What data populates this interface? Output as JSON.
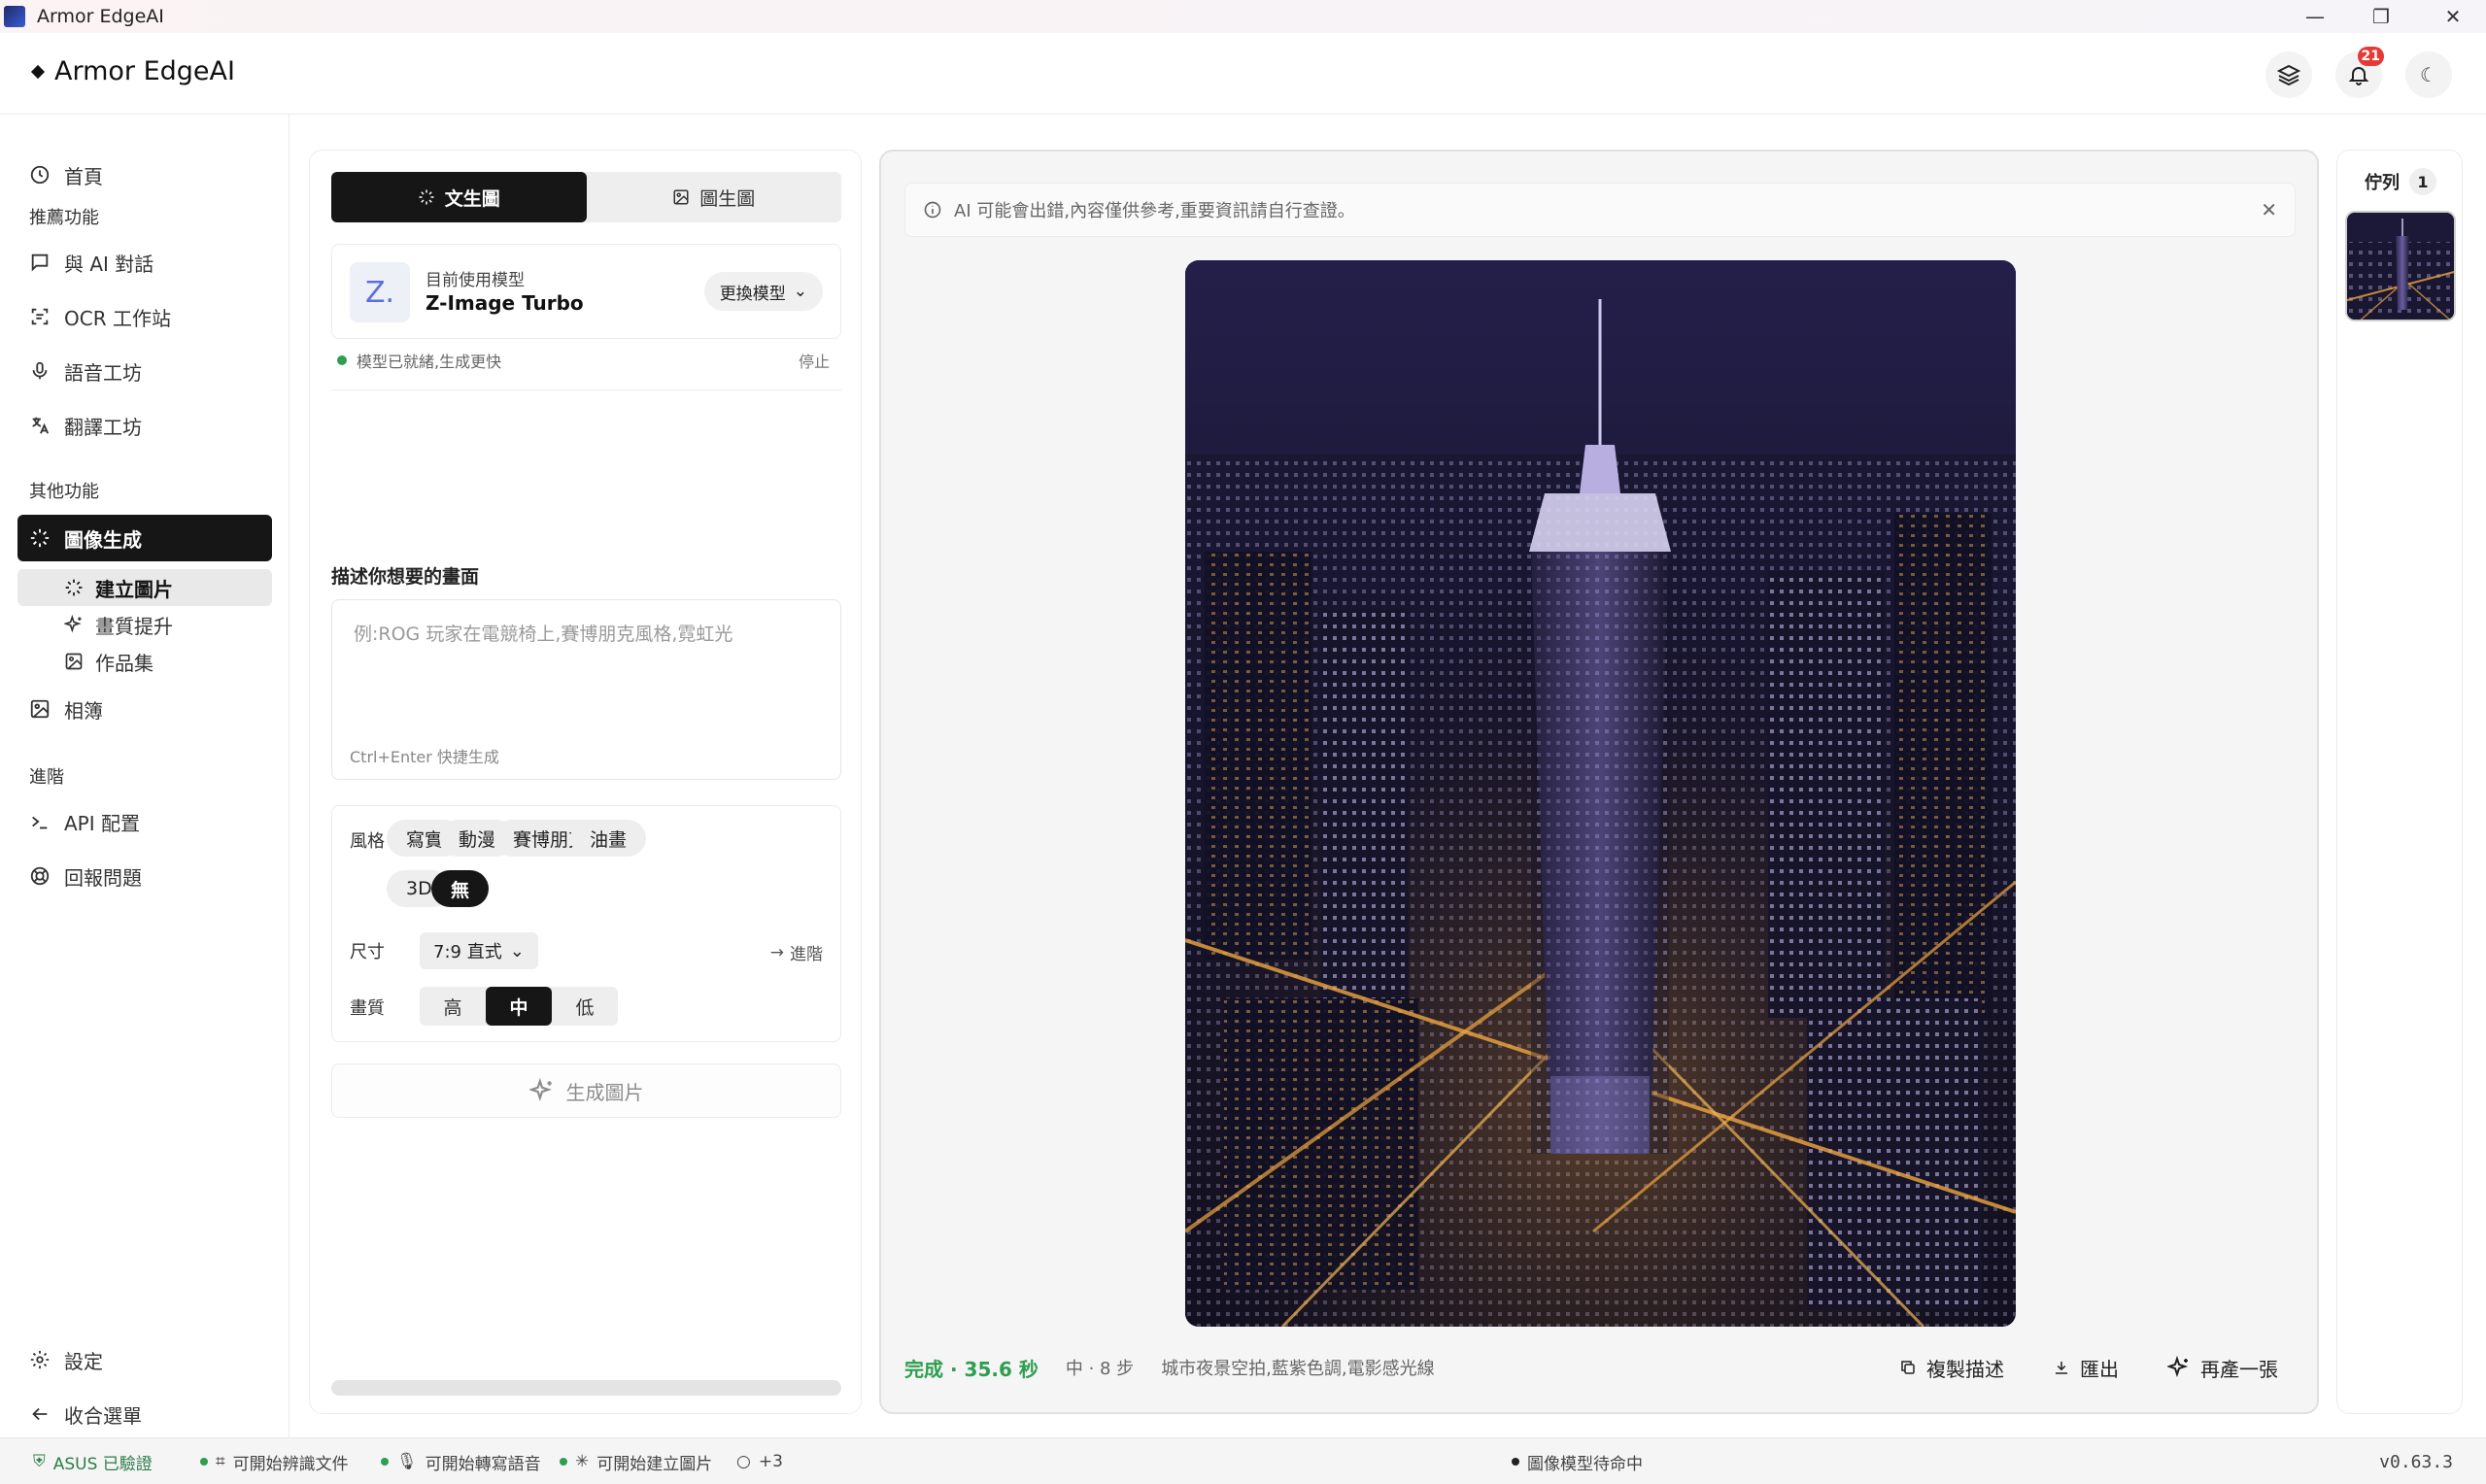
{
  "window": {
    "title": "Armor EdgeAI",
    "min": "—",
    "restore": "❐",
    "close": "✕"
  },
  "header": {
    "brand": "Armor EdgeAI",
    "notifications_count": "21"
  },
  "sidebar": {
    "home": "首頁",
    "section_recommended": "推薦功能",
    "chat": "與 AI 對話",
    "ocr": "OCR 工作站",
    "voice": "語音工坊",
    "translate": "翻譯工坊",
    "section_other": "其他功能",
    "image_gen": "圖像生成",
    "sub_create": "建立圖片",
    "sub_enhance": "畫質提升",
    "sub_gallery": "作品集",
    "album": "相簿",
    "section_advanced": "進階",
    "api": "API 配置",
    "report": "回報問題",
    "settings": "設定",
    "collapse": "收合選單"
  },
  "form": {
    "tab_text2img": "文生圖",
    "tab_img2img": "圖生圖",
    "model_caption": "目前使用模型",
    "model_logo": "Z.",
    "model_name": "Z-Image Turbo",
    "model_switch": "更換模型",
    "ready_text": "模型已就緒,生成更快",
    "stop": "停止",
    "prompt_label": "描述你想要的畫面",
    "prompt_placeholder": "例:ROG 玩家在電競椅上,賽博朋克風格,霓虹光",
    "prompt_hint": "Ctrl+Enter 快捷生成",
    "style_label": "風格",
    "styles": [
      "寫實",
      "動漫",
      "賽博朋克",
      "油畫",
      "3D",
      "無"
    ],
    "size_label": "尺寸",
    "size_value": "7:9 直式",
    "advance": "進階",
    "quality_label": "畫質",
    "quality_high": "高",
    "quality_mid": "中",
    "quality_low": "低",
    "generate": "生成圖片"
  },
  "preview": {
    "notice": "AI 可能會出錯,內容僅供參考,重要資訊請自行查證。",
    "status_done": "完成 · 35.6 秒",
    "meta": "中 · 8 步",
    "description": "城市夜景空拍,藍紫色調,電影感光線",
    "copy": "複製描述",
    "export": "匯出",
    "regen": "再產一張"
  },
  "queue": {
    "title": "佇列",
    "count": "1"
  },
  "statusbar": {
    "verified": "ASUS 已驗證",
    "ocr_ready": "可開始辨識文件",
    "voice_ready": "可開始轉寫語音",
    "image_ready": "可開始建立圖片",
    "more": "+3",
    "model_status": "圖像模型待命中",
    "version": "v0.63.3"
  },
  "colors": {
    "accent": "#161616",
    "success": "#2e9e4f",
    "badge": "#e53935"
  }
}
